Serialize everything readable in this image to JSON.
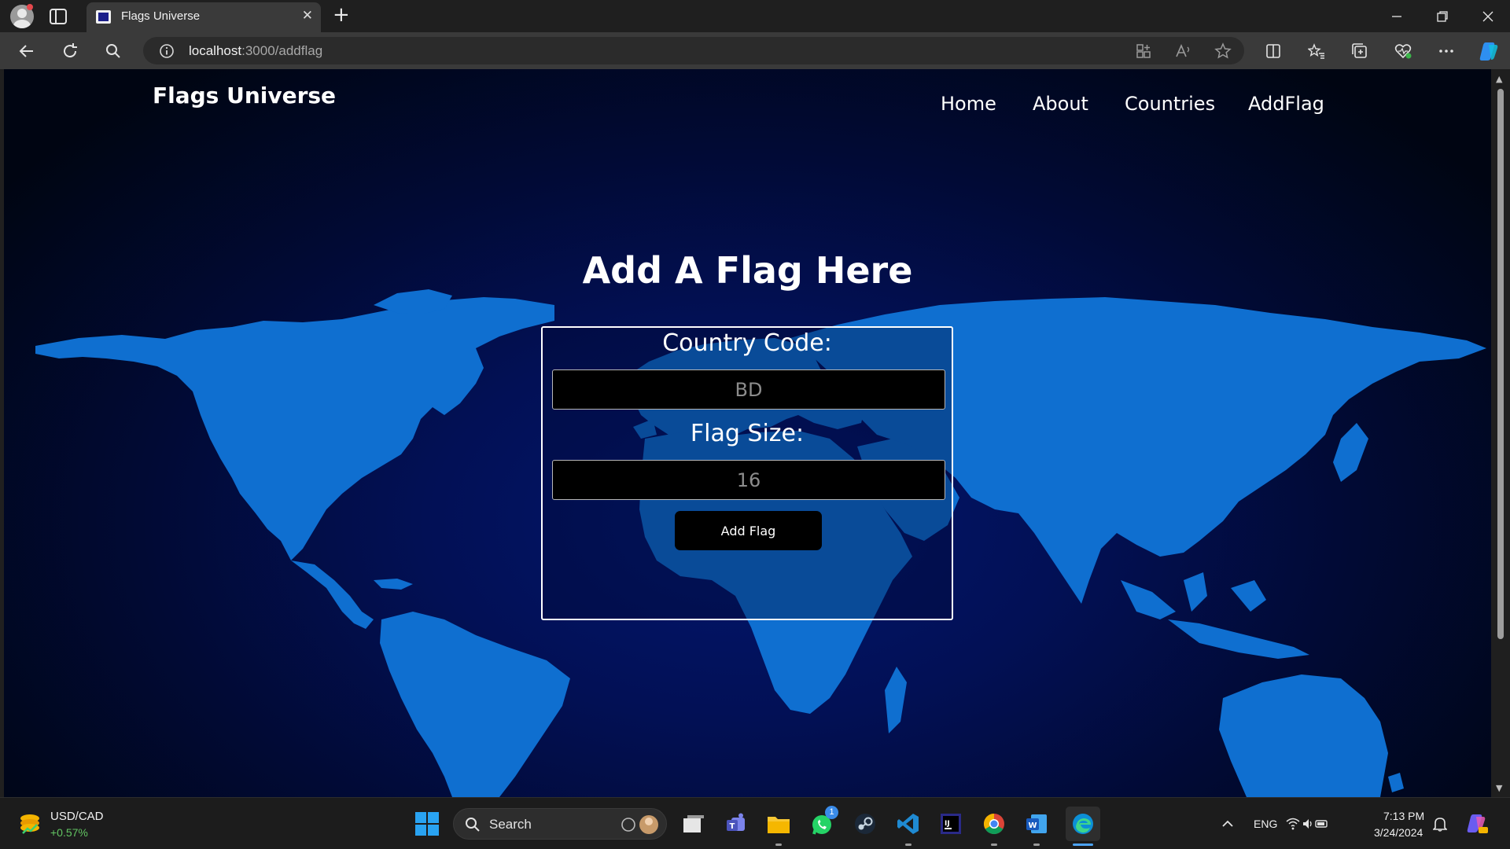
{
  "browser": {
    "tab_title": "Flags Universe",
    "tab_close": "✕",
    "new_tab": "+",
    "url_host": "localhost",
    "url_path": ":3000/addflag"
  },
  "page": {
    "brand": "Flags Universe",
    "nav": [
      "Home",
      "About",
      "Countries",
      "AddFlag"
    ],
    "heading": "Add A Flag Here",
    "form": {
      "country_code_label": "Country Code:",
      "country_code_placeholder": "BD",
      "flag_size_label": "Flag Size:",
      "flag_size_placeholder": "16",
      "submit_label": "Add Flag"
    }
  },
  "taskbar": {
    "widget_title": "USD/CAD",
    "widget_change": "+0.57%",
    "search_label": "Search",
    "whatsapp_badge": "1",
    "language": "ENG",
    "time": "7:13 PM",
    "date": "3/24/2024"
  },
  "colors": {
    "map_land": "#0f6fd0",
    "page_bg_center": "#03166e",
    "page_bg_edge": "#000512",
    "taskbar_accent": "#29a3f2"
  }
}
